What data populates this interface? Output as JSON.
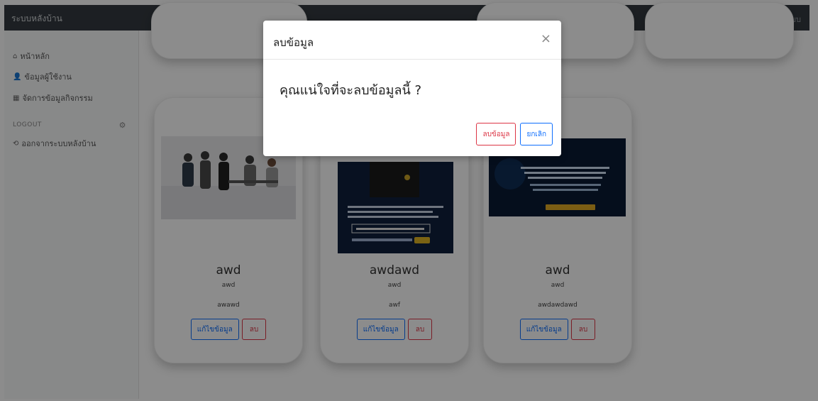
{
  "topbar": {
    "brand": "ระบบหลังบ้าน",
    "user": "ออกจากระบบ"
  },
  "sidebar": {
    "items": [
      {
        "icon": "home-icon",
        "glyph": "⌂",
        "label": "หน้าหลัก"
      },
      {
        "icon": "user-icon",
        "glyph": "👤",
        "label": "ข้อมูลผู้ใช้งาน"
      },
      {
        "icon": "grid-icon",
        "glyph": "▦",
        "label": "จัดการข้อมูลกิจกรรม"
      }
    ],
    "logout_header": "LOGOUT",
    "logout_item": {
      "icon": "logout-icon",
      "glyph": "⟲",
      "label": "ออกจากระบบหลังบ้าน"
    }
  },
  "cards": [
    {
      "name": "awd",
      "sub": "awd",
      "desc": "awawd",
      "edit_label": "แก้ไขข้อมูล",
      "delete_label": "ลบ"
    },
    {
      "name": "awdawd",
      "sub": "awd",
      "desc": "awf",
      "edit_label": "แก้ไขข้อมูล",
      "delete_label": "ลบ"
    },
    {
      "name": "awd",
      "sub": "awd",
      "desc": "awdawdawd",
      "edit_label": "แก้ไขข้อมูล",
      "delete_label": "ลบ"
    }
  ],
  "modal": {
    "title": "ลบข้อมูล",
    "close_glyph": "×",
    "message": "คุณแน่ใจที่จะลบข้อมูลนี้ ?",
    "confirm_label": "ลบข้อมูล",
    "cancel_label": "ยกเลิก"
  },
  "colors": {
    "primary": "#0d6efd",
    "danger": "#dc3545",
    "topbar": "#343a40"
  }
}
